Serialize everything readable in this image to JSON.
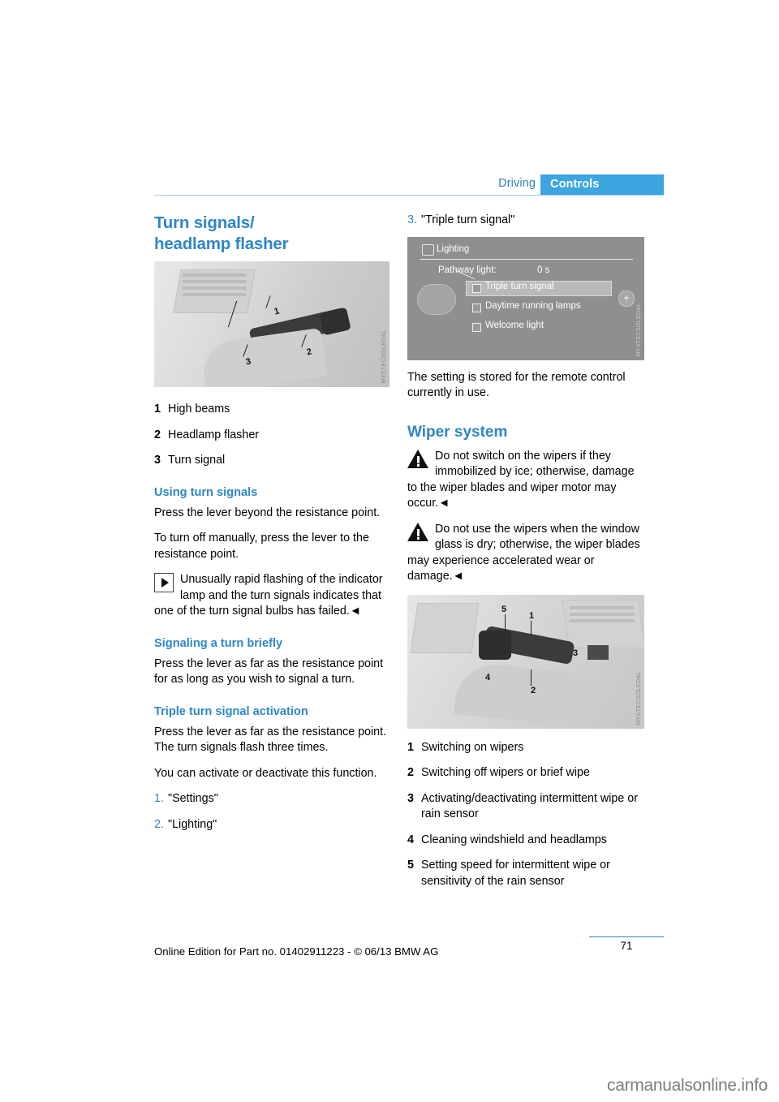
{
  "header": {
    "section_label": "Driving",
    "subsection_label": "Controls"
  },
  "left_column": {
    "title_line1": "Turn signals/",
    "title_line2": "headlamp flasher",
    "image_code": "MYSTECSOLEDAL",
    "legend": [
      {
        "num": "1",
        "text": "High beams"
      },
      {
        "num": "2",
        "text": "Headlamp flasher"
      },
      {
        "num": "3",
        "text": "Turn signal"
      }
    ],
    "subhead_using": "Using turn signals",
    "p_using_1": "Press the lever beyond the resistance point.",
    "p_using_2": "To turn off manually, press the lever to the resistance point.",
    "note_text": "Unusually rapid flashing of the indicator lamp and the turn signals indicates that one of the turn signal bulbs has failed.",
    "note_endmark": "◄",
    "subhead_brief": "Signaling a turn briefly",
    "p_brief": "Press the lever as far as the resistance point for as long as you wish to signal a turn.",
    "subhead_triple": "Triple turn signal activation",
    "p_triple_1": "Press the lever as far as the resistance point. The turn signals flash three times.",
    "p_triple_2": "You can activate or deactivate this function.",
    "steps": [
      {
        "num": "1.",
        "text": "\"Settings\""
      },
      {
        "num": "2.",
        "text": "\"Lighting\""
      }
    ]
  },
  "right_column": {
    "step3": {
      "num": "3.",
      "text": "\"Triple turn signal\""
    },
    "idrive": {
      "title": "Lighting",
      "row_pathway_label": "Pathway light:",
      "row_pathway_value": "0 s",
      "row_triple": "Triple turn signal",
      "row_daytime": "Daytime running lamps",
      "row_welcome": "Welcome light",
      "plus_label": "+"
    },
    "p_stored": "The setting is stored for the remote control currently in use.",
    "section_title": "Wiper system",
    "warn1_text": "Do not switch on the wipers if they immobilized by ice; otherwise, damage to the wiper blades and wiper motor may occur.",
    "warn1_endmark": "◄",
    "warn2_text": "Do not use the wipers when the window glass is dry; otherwise, the wiper blades may experience accelerated wear or damage.",
    "warn2_endmark": "◄",
    "image_code": "MYSTECSOLEDAL",
    "image_callouts": [
      "5",
      "1",
      "3",
      "4",
      "2"
    ],
    "legend": [
      {
        "num": "1",
        "text": "Switching on wipers"
      },
      {
        "num": "2",
        "text": "Switching off wipers or brief wipe"
      },
      {
        "num": "3",
        "text": "Activating/deactivating intermittent wipe or rain sensor"
      },
      {
        "num": "4",
        "text": "Cleaning windshield and headlamps"
      },
      {
        "num": "5",
        "text": "Setting speed for intermittent wipe or sensitivity of the rain sensor"
      }
    ]
  },
  "footer": {
    "page_number": "71",
    "edition_note": "Online Edition for Part no. 01402911223 - © 06/13 BMW AG",
    "watermark": "carmanualsonline.info"
  }
}
